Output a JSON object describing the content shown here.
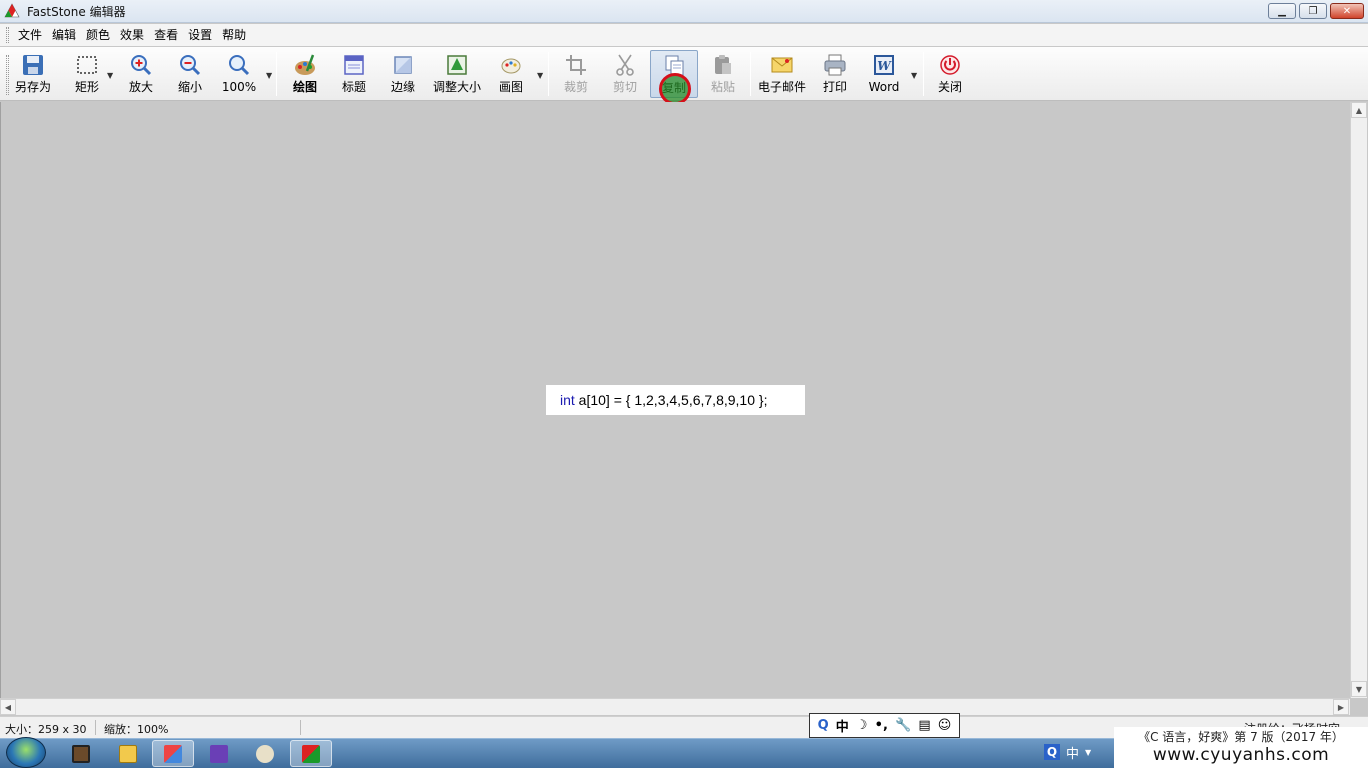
{
  "window": {
    "title": "FastStone 编辑器"
  },
  "menu": [
    "文件",
    "编辑",
    "颜色",
    "效果",
    "查看",
    "设置",
    "帮助"
  ],
  "toolbar": {
    "save_as": "另存为",
    "rectangle": "矩形",
    "zoom_in": "放大",
    "zoom_out": "缩小",
    "zoom_level": "100%",
    "draw": "绘图",
    "caption": "标题",
    "edge": "边缘",
    "resize": "调整大小",
    "paint": "画图",
    "crop": "裁剪",
    "cut": "剪切",
    "copy": "复制",
    "paste": "粘贴",
    "email": "电子邮件",
    "print": "打印",
    "word": "Word",
    "close": "关闭"
  },
  "canvas": {
    "code_keyword": "int",
    "code_rest": " a[10] = { 1,2,3,4,5,6,7,8,9,10 };"
  },
  "status": {
    "size": "大小：259 x 30",
    "zoom": "缩放：100%",
    "registered": "注册给：飞扬时空"
  },
  "ime": {
    "mode": "中"
  },
  "tray": {
    "ime_mode": "中"
  },
  "watermark": {
    "line1": "《C 语言，好爽》第 7 版（2017 年）",
    "line2": "www.cyuyanhs.com"
  },
  "colors": {
    "highlight_ring": "#d4101a",
    "highlight_fill": "#288c28",
    "keyword": "#1a1ab0"
  }
}
